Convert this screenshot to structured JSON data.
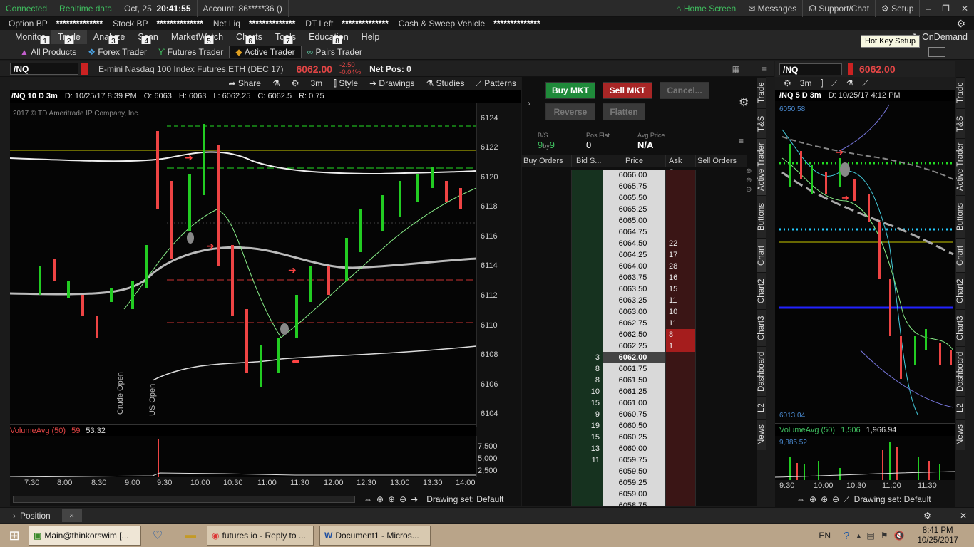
{
  "status": {
    "connected": "Connected",
    "realtime": "Realtime data",
    "date": "Oct, 25",
    "time": "20:41:55",
    "account": "Account: 86*****36 ()",
    "home": "Home Screen",
    "messages": "Messages",
    "support": "Support/Chat",
    "setup": "Setup"
  },
  "acct": {
    "option_bp": "Option BP",
    "option_bp_v": "**************",
    "stock_bp": "Stock BP",
    "stock_bp_v": "**************",
    "net_liq": "Net Liq",
    "net_liq_v": "**************",
    "dt_left": "DT Left",
    "dt_left_v": "**************",
    "cash": "Cash & Sweep Vehicle",
    "cash_v": "**************"
  },
  "menu": [
    {
      "label": "Monitor",
      "hk": "1"
    },
    {
      "label": "Trade",
      "hk": "2"
    },
    {
      "label": "Analyze",
      "hk": "3"
    },
    {
      "label": "Scan",
      "hk": "4"
    },
    {
      "label": "MarketWatch",
      "hk": "5"
    },
    {
      "label": "Charts",
      "hk": "6"
    },
    {
      "label": "Tools",
      "hk": "7"
    },
    {
      "label": "Education",
      "hk": "8"
    },
    {
      "label": "Help",
      "hk": ""
    }
  ],
  "ondemand": "OnDemand",
  "tooltip": "Hot Key Setup",
  "subtabs": [
    "All Products",
    "Forex Trader",
    "Futures Trader",
    "Active Trader",
    "Pairs Trader"
  ],
  "symrow": {
    "symbol": "/NQ",
    "desc": "E-mini Nasdaq 100 Index Futures,ETH (DEC 17)",
    "price": "6062.00",
    "chg": "-2.50",
    "chg_pct": "-0.04%",
    "netpos": "Net Pos: 0"
  },
  "chart1": {
    "toolbar": {
      "share": "Share",
      "period": "3m",
      "style": "Style",
      "drawings": "Drawings",
      "studies": "Studies",
      "patterns": "Patterns"
    },
    "info": {
      "sym": "/NQ 10 D 3m",
      "d": "D: 10/25/17 8:39 PM",
      "o": "O: 6063",
      "h": "H: 6063",
      "l": "L: 6062.25",
      "c": "C: 6062.5",
      "r": "R: 0.75"
    },
    "copyright": "2017 © TD Ameritrade IP Company, Inc.",
    "yticks": [
      "6124",
      "6122",
      "6120",
      "6118",
      "6116",
      "6114",
      "6112",
      "6110",
      "6108",
      "6106",
      "6104"
    ],
    "xticks": [
      "7:30",
      "8:00",
      "8:30",
      "9:00",
      "9:30",
      "10:00",
      "10:30",
      "11:00",
      "11:30",
      "12:00",
      "12:30",
      "13:00",
      "13:30",
      "14:00"
    ],
    "crude": "Crude Open",
    "us": "US Open",
    "vol": {
      "label": "VolumeAvg (50)",
      "v1": "59",
      "v2": "53.32",
      "ticks": [
        "7,500",
        "5,000",
        "2,500"
      ]
    },
    "drawset": "Drawing set: Default"
  },
  "ladder": {
    "buy": "Buy MKT",
    "sell": "Sell MKT",
    "cancel": "Cancel...",
    "reverse": "Reverse",
    "flatten": "Flatten",
    "bs_lbl": "B/S",
    "bs_v1": "9",
    "bs_by": "by",
    "bs_v2": "9",
    "pos_lbl": "Pos Flat",
    "pos_v": "0",
    "avg_lbl": "Avg Price",
    "avg_v": "N/A",
    "headers": [
      "Buy Orders",
      "Bid S...",
      "Price",
      "Ask S...",
      "Sell Orders"
    ],
    "rows": [
      {
        "bid": "",
        "price": "6066.00",
        "ask": ""
      },
      {
        "bid": "",
        "price": "6065.75",
        "ask": ""
      },
      {
        "bid": "",
        "price": "6065.50",
        "ask": ""
      },
      {
        "bid": "",
        "price": "6065.25",
        "ask": ""
      },
      {
        "bid": "",
        "price": "6065.00",
        "ask": ""
      },
      {
        "bid": "",
        "price": "6064.75",
        "ask": ""
      },
      {
        "bid": "",
        "price": "6064.50",
        "ask": "22"
      },
      {
        "bid": "",
        "price": "6064.25",
        "ask": "17"
      },
      {
        "bid": "",
        "price": "6064.00",
        "ask": "28"
      },
      {
        "bid": "",
        "price": "6063.75",
        "ask": "16"
      },
      {
        "bid": "",
        "price": "6063.50",
        "ask": "15"
      },
      {
        "bid": "",
        "price": "6063.25",
        "ask": "11"
      },
      {
        "bid": "",
        "price": "6063.00",
        "ask": "10"
      },
      {
        "bid": "",
        "price": "6062.75",
        "ask": "11"
      },
      {
        "bid": "",
        "price": "6062.50",
        "ask": "8"
      },
      {
        "bid": "",
        "price": "6062.25",
        "ask": "1"
      },
      {
        "bid": "3",
        "price": "6062.00",
        "ask": ""
      },
      {
        "bid": "8",
        "price": "6061.75",
        "ask": ""
      },
      {
        "bid": "8",
        "price": "6061.50",
        "ask": ""
      },
      {
        "bid": "10",
        "price": "6061.25",
        "ask": ""
      },
      {
        "bid": "15",
        "price": "6061.00",
        "ask": ""
      },
      {
        "bid": "9",
        "price": "6060.75",
        "ask": ""
      },
      {
        "bid": "19",
        "price": "6060.50",
        "ask": ""
      },
      {
        "bid": "15",
        "price": "6060.25",
        "ask": ""
      },
      {
        "bid": "13",
        "price": "6060.00",
        "ask": ""
      },
      {
        "bid": "11",
        "price": "6059.75",
        "ask": ""
      },
      {
        "bid": "",
        "price": "6059.50",
        "ask": ""
      },
      {
        "bid": "",
        "price": "6059.25",
        "ask": ""
      },
      {
        "bid": "",
        "price": "6059.00",
        "ask": ""
      },
      {
        "bid": "",
        "price": "6058.75",
        "ask": ""
      }
    ]
  },
  "vtabs": [
    "Trade",
    "T&S",
    "Active Trader",
    "Buttons",
    "Chart",
    "Chart2",
    "Chart3",
    "Dashboard",
    "L2",
    "News"
  ],
  "chart2": {
    "symbol": "/NQ",
    "price": "6062.00",
    "period": "3m",
    "sym": "/NQ 5 D 3m",
    "d": "D: 10/25/17 4:12 PM",
    "hi": "6050.58",
    "lo": "6013.04",
    "vol": {
      "label": "VolumeAvg (50)",
      "v1": "1,506",
      "v2": "1,966.94",
      "v3": "9,885.52"
    },
    "xticks": [
      "9:30",
      "10:00",
      "10:30",
      "11:00",
      "11:30"
    ],
    "drawset": "Drawing set: Default"
  },
  "position": "Position",
  "taskbar": {
    "main": "Main@thinkorswim [...",
    "chrome": "futures io - Reply to ...",
    "word": "Document1 - Micros...",
    "lang": "EN",
    "time": "8:41 PM",
    "date": "10/25/2017"
  }
}
